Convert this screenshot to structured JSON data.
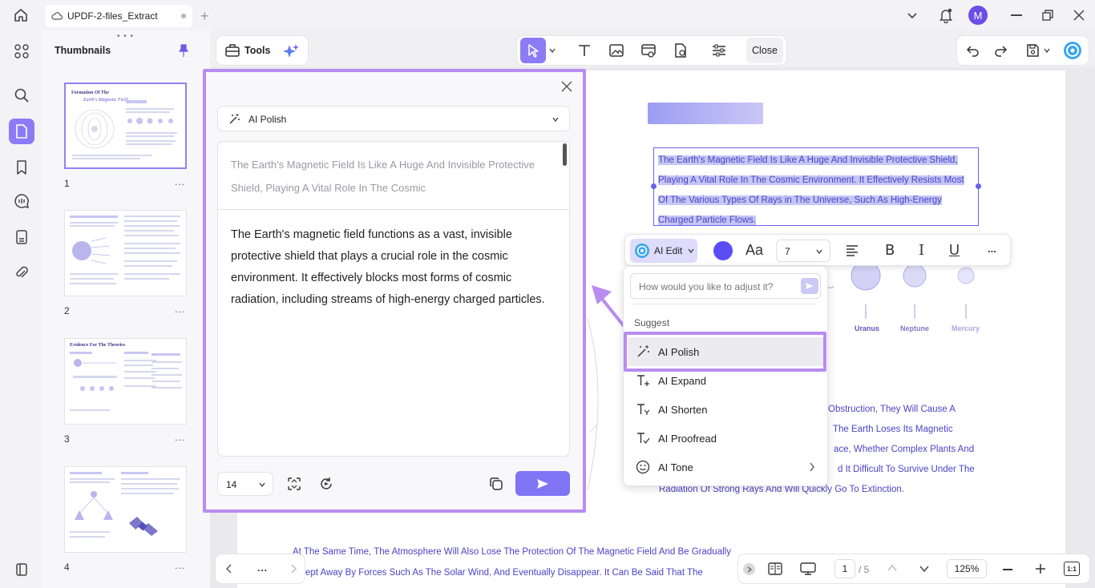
{
  "window": {
    "tab_title": "UPDF-2-files_Extract",
    "avatar_letter": "M"
  },
  "thumbnails": {
    "title": "Thumbnails",
    "pages": [
      {
        "number": "1",
        "more": "...",
        "heading": "Formation Of The",
        "subheading": "Earth's Magnetic Field"
      },
      {
        "number": "2",
        "more": "..."
      },
      {
        "number": "3",
        "more": "...",
        "heading": "Evidence For The Theories"
      },
      {
        "number": "4",
        "more": "..."
      }
    ]
  },
  "toolbar": {
    "tools_label": "Tools",
    "close_label": "Close"
  },
  "ai_panel": {
    "mode_label": "AI Polish",
    "original_text": "The Earth's Magnetic Field Is Like A Huge And Invisible Protective Shield, Playing A Vital Role In The Cosmic",
    "result_text": "The Earth's magnetic field functions as a vast, invisible protective shield that plays a crucial role in the cosmic environment. It effectively blocks most forms of cosmic radiation, including streams of high-energy charged particles.",
    "font_size": "14"
  },
  "document": {
    "selected_text": "The Earth's Magnetic Field Is Like A Huge And Invisible Protective Shield, Playing A Vital Role In The Cosmic Environment. It Effectively Resists Most Of The Various Types Of Rays in The Universe, Such As High-Energy Charged Particle Flows.",
    "planet_labels": [
      "Uranus",
      "Neptune",
      "Mercury"
    ],
    "body_lines": [
      "Obstruction, They Will Cause A",
      "The Earth Loses Its Magnetic",
      "ace, Whether Complex Plants And",
      "d It Difficult To Survive Under The",
      "Radiation Of Strong Rays And Will Quickly Go To Extinction."
    ],
    "bottom_lines": [
      "At The Same Time, The Atmosphere Will Also Lose The Protection Of The Magnetic Field And Be Gradually",
      "Swept Away By Forces Such As The Solar Wind, And Eventually Disappear. It Can Be Said That The"
    ]
  },
  "float_bar": {
    "ai_edit_label": "AI Edit",
    "aa_label": "Aa",
    "size_value": "7",
    "bold": "B",
    "italic": "I",
    "underline": "U",
    "more": "...",
    "color": "#5b4df5"
  },
  "ai_menu": {
    "prompt_placeholder": "How would you like to adjust it?",
    "suggest_label": "Suggest",
    "items": [
      "AI Polish",
      "AI Expand",
      "AI Shorten",
      "AI Proofread",
      "AI Tone"
    ]
  },
  "bottom_nav": {
    "current_page": "1",
    "total_pages": "/ 5",
    "zoom": "125%",
    "fit_label": "1:1",
    "more": "..."
  },
  "colors": {
    "accent": "#8b7cf6",
    "highlight_border": "#b98cf0",
    "selection": "#c4c6f5",
    "link_text": "#4b43c7"
  }
}
